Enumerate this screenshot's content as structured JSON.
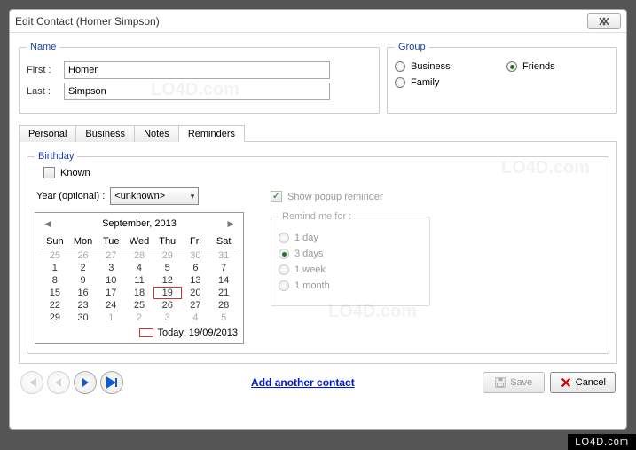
{
  "window": {
    "title": "Edit Contact (Homer Simpson)"
  },
  "name": {
    "legend": "Name",
    "first_label": "First :",
    "first_value": "Homer",
    "last_label": "Last :",
    "last_value": "Simpson"
  },
  "group": {
    "legend": "Group",
    "options": {
      "business": "Business",
      "friends": "Friends",
      "family": "Family"
    },
    "selected": "friends"
  },
  "tabs": {
    "personal": "Personal",
    "business": "Business",
    "notes": "Notes",
    "reminders": "Reminders",
    "active": "reminders"
  },
  "birthday": {
    "legend": "Birthday",
    "known_label": "Known",
    "year_label": "Year (optional) :",
    "year_value": "<unknown>",
    "popup_label": "Show popup reminder",
    "remind_legend": "Remind me for :",
    "remind_options": {
      "d1": "1 day",
      "d3": "3 days",
      "w1": "1 week",
      "m1": "1 month"
    }
  },
  "calendar": {
    "month_label": "September, 2013",
    "dow": [
      "Sun",
      "Mon",
      "Tue",
      "Wed",
      "Thu",
      "Fri",
      "Sat"
    ],
    "weeks": [
      [
        {
          "n": 25,
          "m": true
        },
        {
          "n": 26,
          "m": true
        },
        {
          "n": 27,
          "m": true
        },
        {
          "n": 28,
          "m": true
        },
        {
          "n": 29,
          "m": true
        },
        {
          "n": 30,
          "m": true
        },
        {
          "n": 31,
          "m": true
        }
      ],
      [
        {
          "n": 1
        },
        {
          "n": 2
        },
        {
          "n": 3
        },
        {
          "n": 4
        },
        {
          "n": 5
        },
        {
          "n": 6
        },
        {
          "n": 7
        }
      ],
      [
        {
          "n": 8
        },
        {
          "n": 9
        },
        {
          "n": 10
        },
        {
          "n": 11
        },
        {
          "n": 12
        },
        {
          "n": 13
        },
        {
          "n": 14
        }
      ],
      [
        {
          "n": 15
        },
        {
          "n": 16
        },
        {
          "n": 17
        },
        {
          "n": 18
        },
        {
          "n": 19,
          "today": true
        },
        {
          "n": 20
        },
        {
          "n": 21
        }
      ],
      [
        {
          "n": 22
        },
        {
          "n": 23
        },
        {
          "n": 24
        },
        {
          "n": 25
        },
        {
          "n": 26
        },
        {
          "n": 27
        },
        {
          "n": 28
        }
      ],
      [
        {
          "n": 29
        },
        {
          "n": 30
        },
        {
          "n": 1,
          "m": true
        },
        {
          "n": 2,
          "m": true
        },
        {
          "n": 3,
          "m": true
        },
        {
          "n": 4,
          "m": true
        },
        {
          "n": 5,
          "m": true
        }
      ]
    ],
    "today_label": "Today: 19/09/2013"
  },
  "footer": {
    "add_link": "Add another contact",
    "save": "Save",
    "cancel": "Cancel"
  },
  "watermark": "LO4D.com"
}
